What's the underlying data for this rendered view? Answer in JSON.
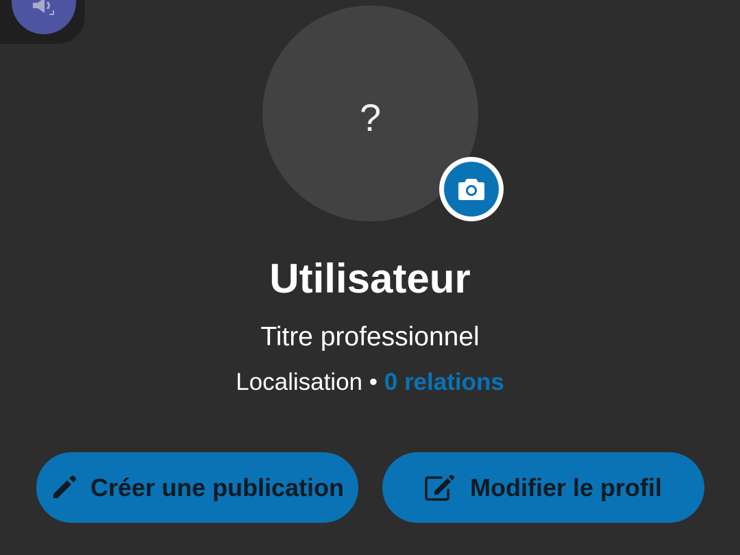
{
  "overlay": {
    "icon": "volume-settings-icon",
    "color": "#4d55a2"
  },
  "profile": {
    "avatar_placeholder": "?",
    "camera_icon": "camera-icon",
    "name": "Utilisateur",
    "headline": "Titre professionnel",
    "location": "Localisation",
    "separator": "•",
    "connections": "0 relations"
  },
  "actions": {
    "create_post": {
      "label": "Créer une publication",
      "icon": "pencil-icon"
    },
    "edit_profile": {
      "label": "Modifier le profil",
      "icon": "edit-square-icon"
    }
  },
  "colors": {
    "background": "#2d2d2d",
    "accent": "#0a73b5",
    "avatar_background": "#424242",
    "text": "#ffffff"
  }
}
